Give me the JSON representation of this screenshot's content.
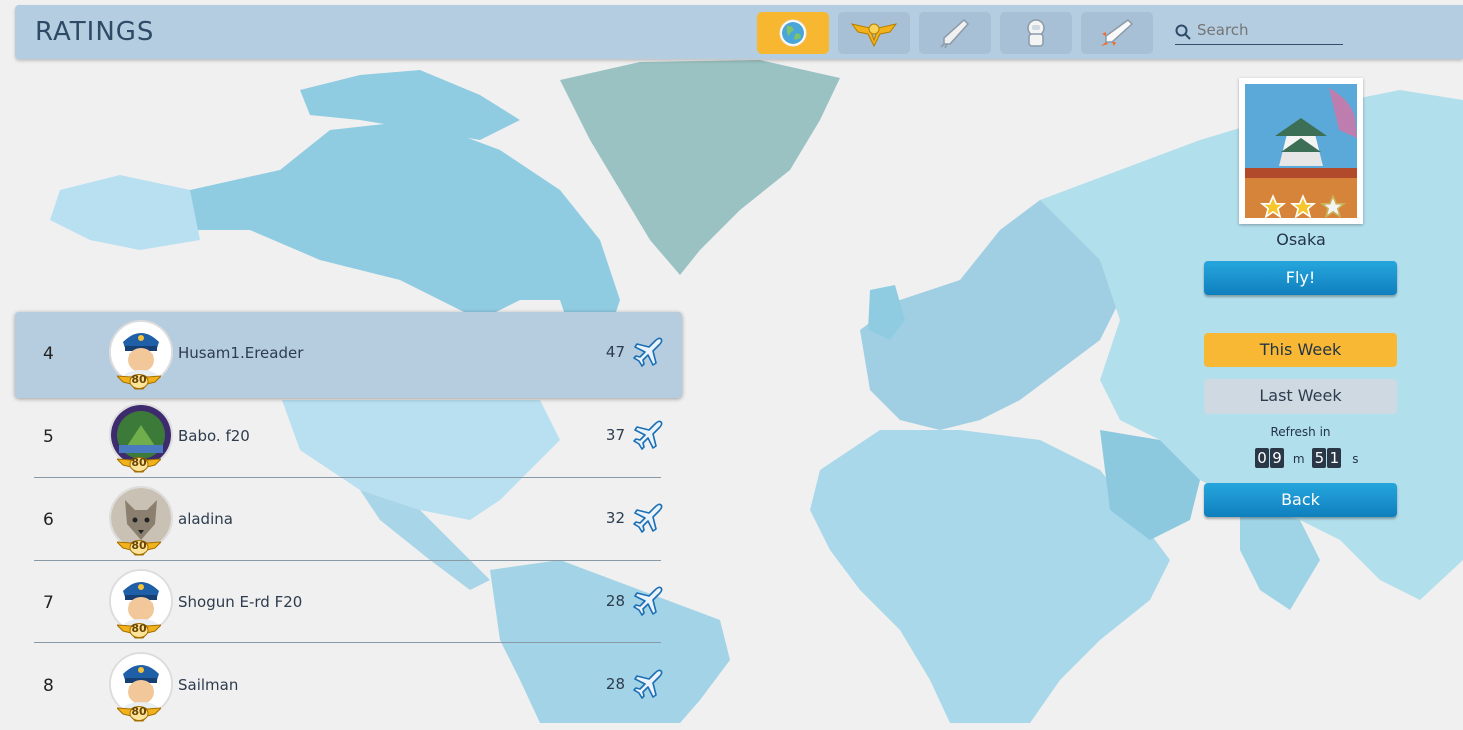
{
  "header": {
    "title": "RATINGS",
    "search_placeholder": "Search"
  },
  "tabs": [
    {
      "icon": "globe-icon",
      "active": true
    },
    {
      "icon": "wings-badge-icon",
      "active": false
    },
    {
      "icon": "rocket-icon",
      "active": false
    },
    {
      "icon": "astronaut-icon",
      "active": false
    },
    {
      "icon": "space-shuttle-icon",
      "active": false
    }
  ],
  "leaderboard": [
    {
      "rank": "4",
      "name": "Husam1.Ereader",
      "score": "47",
      "level": "80",
      "avatar": "pilot",
      "highlight": true
    },
    {
      "rank": "5",
      "name": "Babo. f20",
      "score": "37",
      "level": "80",
      "avatar": "photo-forest",
      "highlight": false
    },
    {
      "rank": "6",
      "name": "aladina",
      "score": "32",
      "level": "80",
      "avatar": "photo-wolf",
      "highlight": false
    },
    {
      "rank": "7",
      "name": "Shogun E-rd F20",
      "score": "28",
      "level": "80",
      "avatar": "pilot",
      "highlight": false
    },
    {
      "rank": "8",
      "name": "Sailman",
      "score": "28",
      "level": "80",
      "avatar": "pilot",
      "highlight": false
    }
  ],
  "destination": {
    "city": "Osaka",
    "stars": 2,
    "max_stars": 3
  },
  "buttons": {
    "fly": "Fly!",
    "this_week": "This Week",
    "last_week": "Last Week",
    "back": "Back"
  },
  "refresh": {
    "label": "Refresh in",
    "minutes": [
      "0",
      "9"
    ],
    "seconds": [
      "5",
      "1"
    ],
    "m_unit": "m",
    "s_unit": "s"
  },
  "colors": {
    "topbar": "#b5cde0",
    "active_tab": "#f7b731",
    "button_blue": "#1a93d1",
    "map_land": "#9ed2e6"
  }
}
